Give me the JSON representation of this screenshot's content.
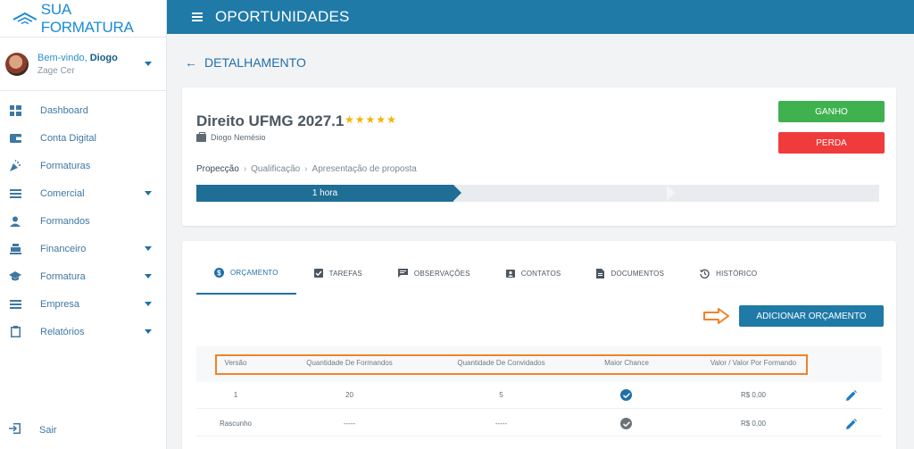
{
  "sidebar": {
    "brand": "SUA FORMATURA",
    "user": {
      "greeting": "Bem-vindo, ",
      "name": "Diogo",
      "company": "Zage Cer"
    },
    "items": [
      {
        "label": "Dashboard",
        "icon": "dashboard-icon",
        "expandable": false
      },
      {
        "label": "Conta Digital",
        "icon": "wallet-icon",
        "expandable": false
      },
      {
        "label": "Formaturas",
        "icon": "party-icon",
        "expandable": false
      },
      {
        "label": "Comercial",
        "icon": "list-icon",
        "expandable": true
      },
      {
        "label": "Formandos",
        "icon": "person-icon",
        "expandable": false
      },
      {
        "label": "Financeiro",
        "icon": "cash-register-icon",
        "expandable": true
      },
      {
        "label": "Formatura",
        "icon": "graduation-cap-icon",
        "expandable": true
      },
      {
        "label": "Empresa",
        "icon": "list-icon",
        "expandable": true
      },
      {
        "label": "Relatórios",
        "icon": "clipboard-icon",
        "expandable": true
      }
    ],
    "logout_label": "Sair"
  },
  "header": {
    "title": "OPORTUNIDADES"
  },
  "detail": {
    "back_label": "DETALHAMENTO",
    "project_title": "Direito UFMG 2027.1",
    "rating": 5,
    "owner": "Diogo Nemésio",
    "won_label": "GANHO",
    "lost_label": "PERDA",
    "breadcrumb": [
      "Propecção",
      "Qualificação",
      "Apresentação de proposta"
    ],
    "pipeline_label": "1 hora",
    "pipeline_progress": 0.375
  },
  "tabs": [
    {
      "label": "ORÇAMENTO",
      "icon": "dollar-icon",
      "active": true
    },
    {
      "label": "TAREFAS",
      "icon": "checkbox-icon",
      "active": false
    },
    {
      "label": "OBSERVAÇÕES",
      "icon": "comment-icon",
      "active": false
    },
    {
      "label": "CONTATOS",
      "icon": "contact-icon",
      "active": false
    },
    {
      "label": "DOCUMENTOS",
      "icon": "document-icon",
      "active": false
    },
    {
      "label": "HISTÓRICO",
      "icon": "history-icon",
      "active": false
    }
  ],
  "add_budget_label": "ADICIONAR ORÇAMENTO",
  "table": {
    "columns": [
      "Versão",
      "Quantidade De Formandos",
      "Quantidade De Convidados",
      "Maior Chance",
      "Valor / Valor Por Formando"
    ],
    "rows": [
      {
        "version": "1",
        "graduates": "20",
        "guests": "5",
        "highest_chance": true,
        "value": "R$ 0,00"
      },
      {
        "version": "Rascunho",
        "graduates": "-----",
        "guests": "-----",
        "highest_chance": false,
        "value": "R$ 0,00"
      }
    ]
  },
  "colors": {
    "primary": "#1f7aa8",
    "won": "#3fb24f",
    "lost": "#ef3b3b",
    "highlight": "#f0822a",
    "star": "#f4b400"
  }
}
